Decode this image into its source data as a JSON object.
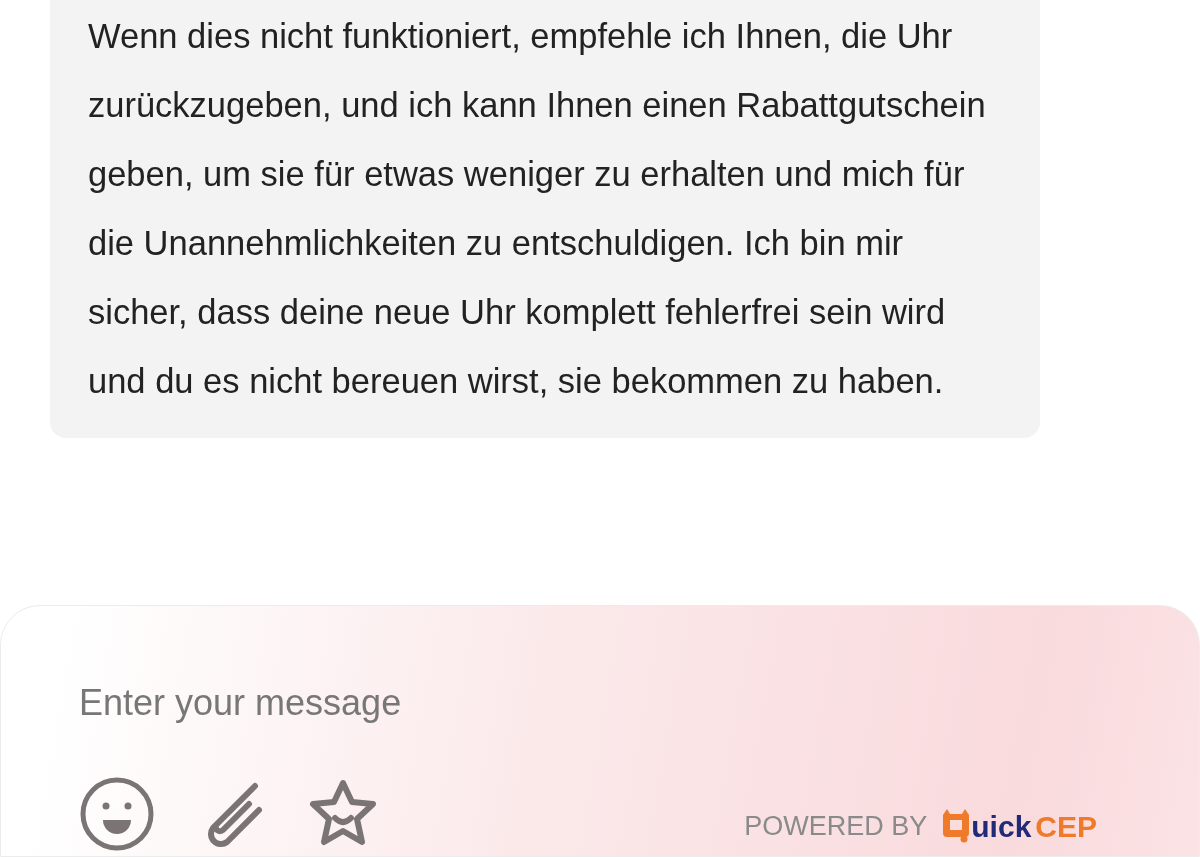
{
  "message": {
    "text": "Wenn dies nicht funktioniert, empfehle ich Ihnen, die Uhr zurückzugeben, und ich kann Ihnen einen Rabattgutschein geben, um sie für etwas weniger zu erhalten und mich für die Unannehmlichkeiten zu entschuldigen. Ich bin mir sicher, dass deine neue Uhr komplett fehlerfrei sein wird und du es nicht bereuen wirst, sie bekommen zu haben."
  },
  "composer": {
    "placeholder": "Enter your message"
  },
  "branding": {
    "powered_by": "POWERED BY",
    "logo_main": "uick",
    "logo_accent": "CEP"
  }
}
